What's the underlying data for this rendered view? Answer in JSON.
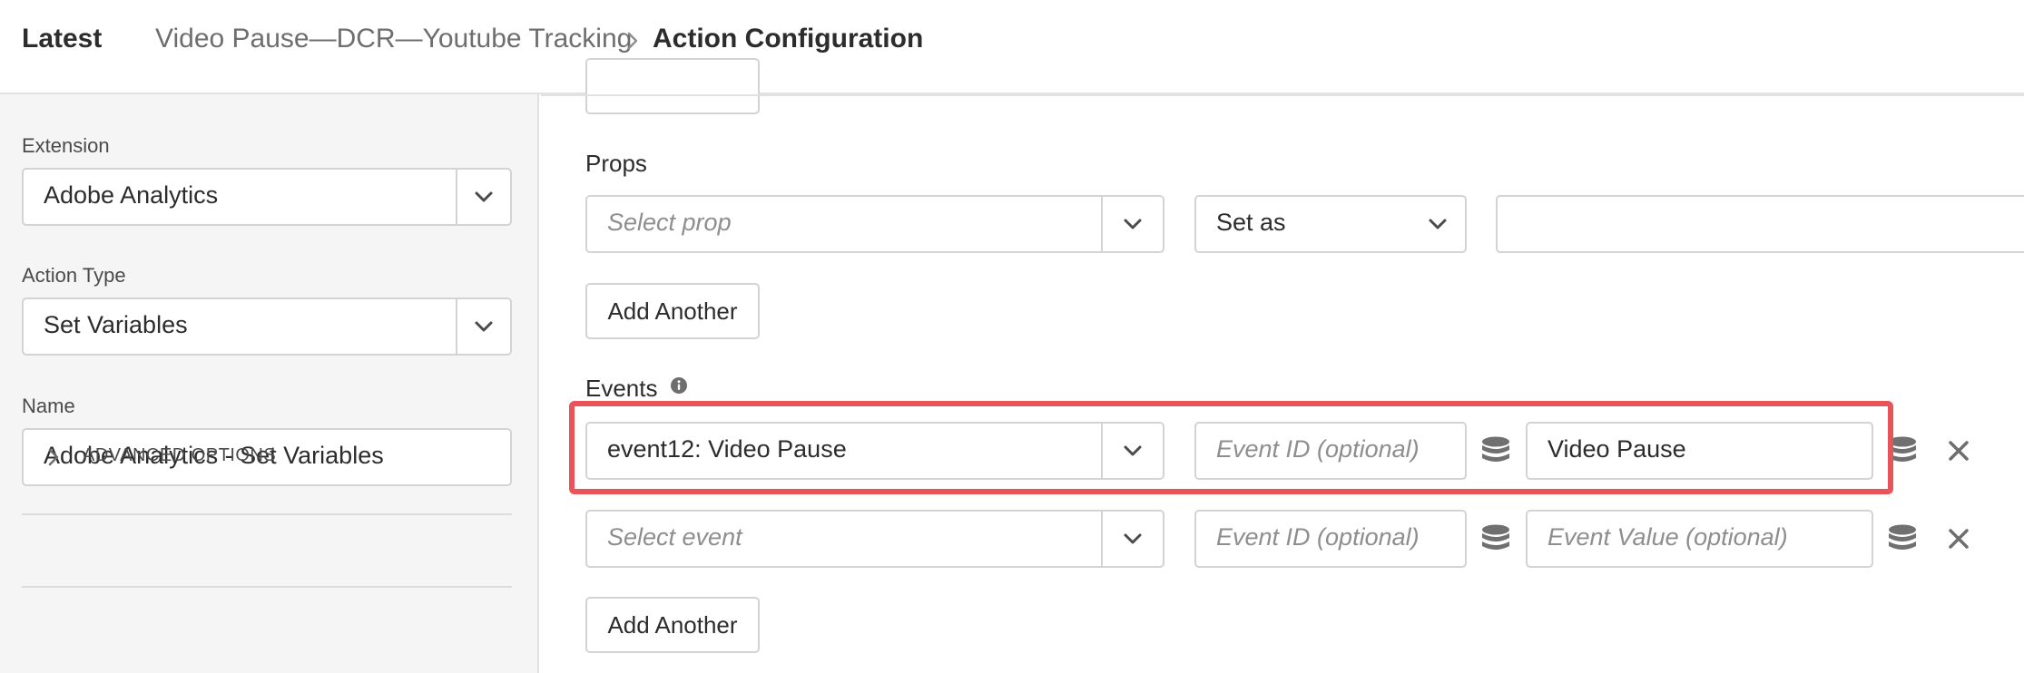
{
  "header": {
    "latest_label": "Latest",
    "rule_name": "Video Pause—DCR—Youtube Tracking",
    "current_page": "Action Configuration"
  },
  "sidebar": {
    "extension_label": "Extension",
    "extension_value": "Adobe Analytics",
    "action_type_label": "Action Type",
    "action_type_value": "Set Variables",
    "name_label": "Name",
    "name_value": "Adobe Analytics - Set Variables",
    "advanced_options_label": "ADVANCED OPTIONS"
  },
  "props": {
    "section_title": "Props",
    "select_placeholder": "Select prop",
    "set_as_value": "Set as",
    "value_field": "",
    "add_another_label": "Add Another"
  },
  "events": {
    "section_title": "Events",
    "rows": [
      {
        "event": "event12: Video Pause",
        "event_id_placeholder": "Event ID (optional)",
        "event_value": "Video Pause"
      },
      {
        "event_placeholder": "Select event",
        "event_id_placeholder": "Event ID (optional)",
        "event_value_placeholder": "Event Value (optional)"
      }
    ],
    "add_another_label": "Add Another"
  },
  "colors": {
    "highlight": "#e8545a",
    "sidebar_bg": "#f5f5f5",
    "border": "#d3d3d3"
  }
}
